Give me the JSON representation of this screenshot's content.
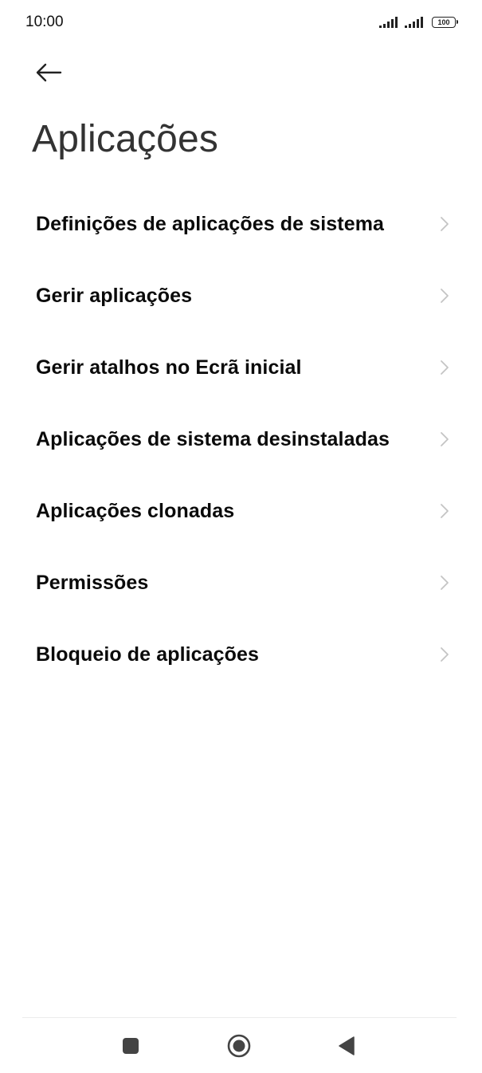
{
  "status_bar": {
    "time": "10:00",
    "battery_level": "100",
    "icons": [
      "signal-icon",
      "signal-icon",
      "battery-icon"
    ]
  },
  "header": {
    "back_icon": "arrow-left-icon",
    "title": "Aplicações"
  },
  "menu": {
    "chevron_icon": "chevron-right-icon",
    "items": [
      {
        "label": "Definições de aplicações de sistema"
      },
      {
        "label": "Gerir aplicações"
      },
      {
        "label": "Gerir atalhos no Ecrã inicial"
      },
      {
        "label": "Aplicações de sistema desinstaladas"
      },
      {
        "label": "Aplicações clonadas"
      },
      {
        "label": "Permissões"
      },
      {
        "label": "Bloqueio de aplicações"
      }
    ]
  },
  "nav_bar": {
    "icons": [
      "recents-square-icon",
      "home-circle-icon",
      "back-triangle-icon"
    ]
  },
  "colors": {
    "background": "#ffffff",
    "text_primary": "#0a0a0a",
    "title_text": "#333333",
    "chevron": "#c4c4c4",
    "nav_icons": "#444444"
  }
}
